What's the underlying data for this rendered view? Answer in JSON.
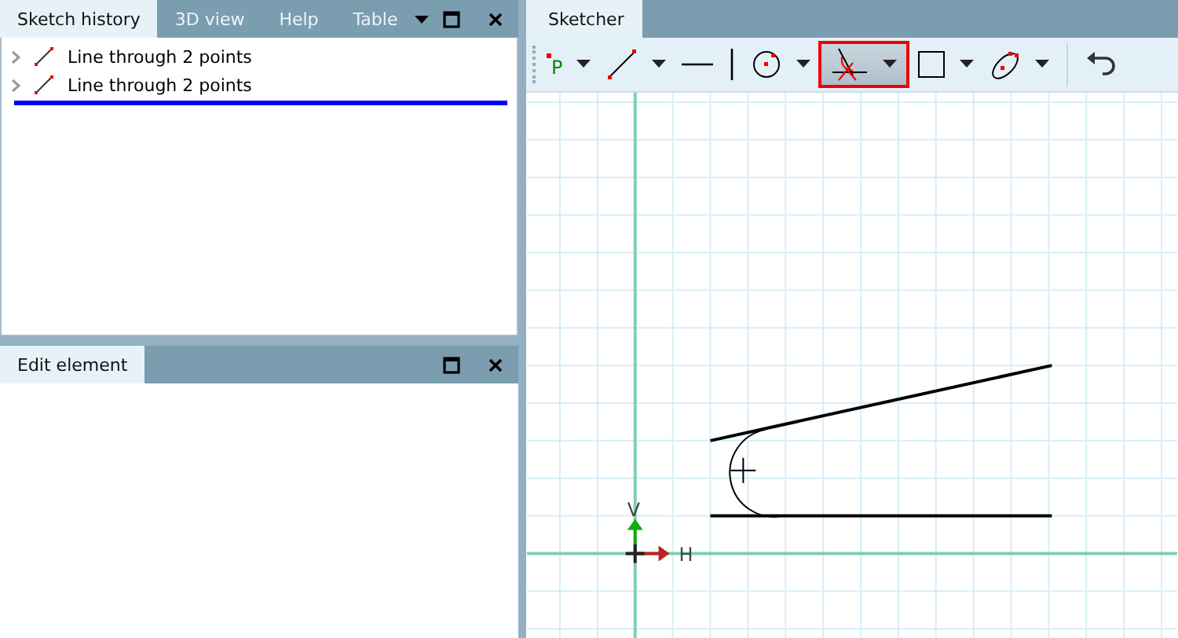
{
  "left_tabs": [
    {
      "label": "Sketch history",
      "selected": true
    },
    {
      "label": "3D view",
      "selected": false
    },
    {
      "label": "Help",
      "selected": false
    },
    {
      "label": "Table",
      "selected": false
    }
  ],
  "history": [
    {
      "label": "Line through 2 points",
      "expanded": false
    },
    {
      "label": "Line through 2 points",
      "expanded": false
    }
  ],
  "edit_panel": {
    "tab": "Edit element"
  },
  "sketcher": {
    "tab": "Sketcher",
    "tools": [
      {
        "kind": "point",
        "label": "P",
        "dropdown": true,
        "selected": false
      },
      {
        "kind": "line",
        "dropdown": true,
        "selected": false
      },
      {
        "kind": "hline",
        "selected": false
      },
      {
        "kind": "vline",
        "selected": false
      },
      {
        "kind": "circle",
        "dropdown": true,
        "selected": false
      },
      {
        "kind": "fillet",
        "dropdown": true,
        "selected": true
      },
      {
        "kind": "rect",
        "dropdown": true,
        "selected": false
      },
      {
        "kind": "ellipse",
        "dropdown": true,
        "selected": false
      },
      {
        "kind": "separator"
      },
      {
        "kind": "undo",
        "selected": false
      }
    ],
    "axes": {
      "v": "V",
      "h": "H"
    }
  }
}
